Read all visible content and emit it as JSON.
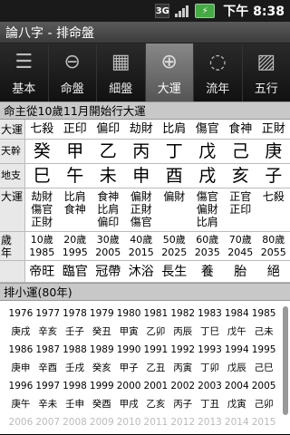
{
  "status": {
    "network": "3G",
    "time": "下午 8:38"
  },
  "app_title": "論八字 - 排命盤",
  "tabs": [
    {
      "label": "基本"
    },
    {
      "label": "命盤"
    },
    {
      "label": "細盤"
    },
    {
      "label": "大運"
    },
    {
      "label": "流年"
    },
    {
      "label": "五行"
    }
  ],
  "dayun_header": "命主從10歲11月開始行大運",
  "row_labels": {
    "dayun": "大運",
    "tiangan": "天幹",
    "dizhi": "地支",
    "dayun2": "大運",
    "age": "歲\n年"
  },
  "dayun_shishen": [
    "七殺",
    "正印",
    "偏印",
    "劫財",
    "比肩",
    "傷官",
    "食神",
    "正財"
  ],
  "tiangan": [
    "癸",
    "甲",
    "乙",
    "丙",
    "丁",
    "戊",
    "己",
    "庚"
  ],
  "dizhi": [
    "巳",
    "午",
    "未",
    "申",
    "酉",
    "戌",
    "亥",
    "子"
  ],
  "canggan": [
    "劫財\n傷官\n正財",
    "比肩\n食神",
    "食神\n比肩\n偏印",
    "偏財\n正財\n傷官",
    "偏財",
    "傷官\n偏財\n比肩",
    "正官\n正印",
    "七殺"
  ],
  "ages": [
    "10歲\n1985",
    "20歲\n1995",
    "30歲\n2005",
    "40歲\n2015",
    "50歲\n2025",
    "60歲\n2035",
    "70歲\n2045",
    "80歲\n2055"
  ],
  "changsheng": [
    "帝旺",
    "臨官",
    "冠帶",
    "沐浴",
    "長生",
    "養",
    "胎",
    "絕"
  ],
  "xiaoyun_header": "排小運(80年)",
  "xiaoyun_rows": [
    [
      "1976",
      "1977",
      "1978",
      "1979",
      "1980",
      "1981",
      "1982",
      "1983",
      "1984",
      "1985"
    ],
    [
      "庚戌",
      "辛亥",
      "壬子",
      "癸丑",
      "甲寅",
      "乙卯",
      "丙辰",
      "丁巳",
      "戊午",
      "己未"
    ],
    [
      "1986",
      "1987",
      "1988",
      "1989",
      "1990",
      "1991",
      "1992",
      "1993",
      "1994",
      "1995"
    ],
    [
      "庚申",
      "辛酉",
      "壬戌",
      "癸亥",
      "甲子",
      "乙丑",
      "丙寅",
      "丁卯",
      "戊辰",
      "己巳"
    ],
    [
      "1996",
      "1997",
      "1998",
      "1999",
      "2000",
      "2001",
      "2002",
      "2003",
      "2004",
      "2005"
    ],
    [
      "庚午",
      "辛未",
      "壬申",
      "癸酉",
      "甲戌",
      "乙亥",
      "丙子",
      "丁丑",
      "戊寅",
      "己卯"
    ],
    [
      "2006",
      "2007",
      "2008",
      "2009",
      "2010",
      "2011",
      "2012",
      "2013",
      "2014",
      "2015"
    ]
  ]
}
